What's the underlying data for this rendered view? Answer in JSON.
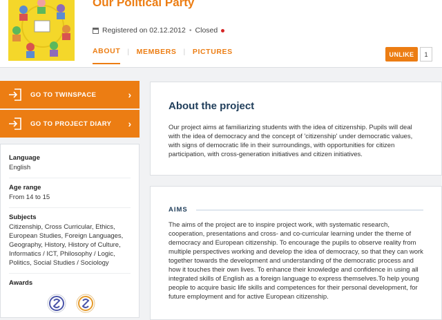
{
  "header": {
    "title": "Our Political Party",
    "registered": "Registered on 02.12.2012",
    "separator": "•",
    "status": "Closed",
    "tabs": [
      {
        "label": "ABOUT"
      },
      {
        "label": "MEMBERS"
      },
      {
        "label": "PICTURES"
      }
    ],
    "tab_separator": "|",
    "unlike_label": "UNLIKE",
    "like_count": "1"
  },
  "sidebar": {
    "twinspace_label": "GO TO TWINSPACE",
    "diary_label": "GO TO PROJECT DIARY",
    "chevron": "›",
    "language_label": "Language",
    "language_value": "English",
    "age_label": "Age range",
    "age_value": "From 14 to 15",
    "subjects_label": "Subjects",
    "subjects_value": "Citizenship, Cross Curricular, Ethics, European Studies, Foreign Languages, Geography, History, History of Culture, Informatics / ICT, Philosophy / Logic, Politics, Social Studies / Sociology",
    "awards_label": "Awards"
  },
  "about": {
    "heading": "About the project",
    "text": "Our project aims at familiarizing students with the idea of citizenship. Pupils will deal with the idea of democracy and the concept of 'citizenship' under democratic values, with signs of democratic life in their surroundings, with opportunities for citizen participation, with cross-generation initiatives and citizen initiatives."
  },
  "aims": {
    "heading": "AIMS",
    "text": "The aims of the project are to inspire project work, with systematic research, cooperation, presentations and cross- and co-curricular learning under the theme of democracy and European citizenship. To encourage the pupils to observe reality from multiple perspectives working and develop the idea of democracy, so that they can work together towards the development and understanding of the democratic process and how it touches their own lives. To enhance their knowledge and confidence in using all integrated skills of English as a foreign language to express themselves.To help young people to acquire basic life skills and competences for their personal development, for future employment and for active European citizenship."
  },
  "colors": {
    "accent": "#ec7d13",
    "heading": "#1f3d5a",
    "closed_dot": "#d62525"
  },
  "icons": [
    "calendar-icon",
    "login-arrow-icon",
    "chevron-right-icon",
    "award-badge-icon"
  ]
}
